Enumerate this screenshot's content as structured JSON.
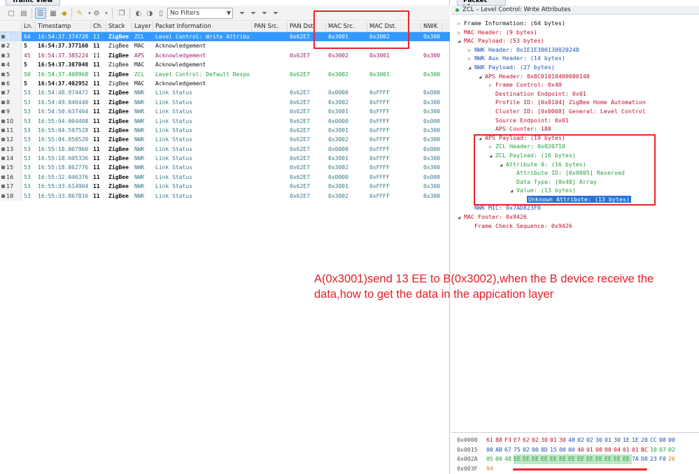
{
  "traffic_view": {
    "title": "Traffic View",
    "filter_value": "No Filters",
    "columns": [
      "Ln.",
      "Timestamp",
      "Ch.",
      "Stack",
      "Layer",
      "Packet Information",
      "PAN Src.",
      "PAN Dst.",
      "MAC Src.",
      "MAC Dst.",
      "NWK"
    ],
    "rows": [
      {
        "ln": "1",
        "prefix": "64",
        "ts": "16:54:37.374728",
        "ch": "11",
        "stack": "ZigBee",
        "layer": "ZCL",
        "info": "Level Control: Write Attribu",
        "pan_src": "",
        "pan_dst": "0x62E7",
        "mac_src": "0x3001",
        "mac_dst": "0x3002",
        "nwk": "0x300",
        "kind": "zcl",
        "selected": true
      },
      {
        "ln": "2",
        "prefix": "5",
        "ts": "16:54:37.377160",
        "ch": "11",
        "stack": "ZigBee",
        "layer": "MAC",
        "info": "Acknowledgement",
        "pan_src": "",
        "pan_dst": "",
        "mac_src": "",
        "mac_dst": "",
        "nwk": "",
        "kind": "mac"
      },
      {
        "ln": "3",
        "prefix": "45",
        "ts": "16:54:37.385224",
        "ch": "11",
        "stack": "ZigBee",
        "layer": "APS",
        "info": "Acknowledgement",
        "pan_src": "",
        "pan_dst": "0x62E7",
        "mac_src": "0x3002",
        "mac_dst": "0x3001",
        "nwk": "0x300",
        "kind": "aps"
      },
      {
        "ln": "4",
        "prefix": "5",
        "ts": "16:54:37.387048",
        "ch": "11",
        "stack": "ZigBee",
        "layer": "MAC",
        "info": "Acknowledgement",
        "pan_src": "",
        "pan_dst": "",
        "mac_src": "",
        "mac_dst": "",
        "nwk": "",
        "kind": "mac"
      },
      {
        "ln": "5",
        "prefix": "50",
        "ts": "16:54:37.400968",
        "ch": "11",
        "stack": "ZigBee",
        "layer": "ZCL",
        "info": "Level Control: Default Respo",
        "pan_src": "",
        "pan_dst": "0x62E7",
        "mac_src": "0x3002",
        "mac_dst": "0x3001",
        "nwk": "0x300",
        "kind": "zcl"
      },
      {
        "ln": "6",
        "prefix": "5",
        "ts": "16:54:37.402952",
        "ch": "11",
        "stack": "ZigBee",
        "layer": "MAC",
        "info": "Acknowledgement",
        "pan_src": "",
        "pan_dst": "",
        "mac_src": "",
        "mac_dst": "",
        "nwk": "",
        "kind": "mac"
      },
      {
        "ln": "7",
        "prefix": "53",
        "ts": "16:54:48.974472",
        "ch": "11",
        "stack": "ZigBee",
        "layer": "NWK",
        "info": "Link Status",
        "pan_src": "",
        "pan_dst": "0x62E7",
        "mac_src": "0x0000",
        "mac_dst": "0xFFFF",
        "nwk": "0x000",
        "kind": "nwk"
      },
      {
        "ln": "8",
        "prefix": "53",
        "ts": "16:54:49.846440",
        "ch": "11",
        "stack": "ZigBee",
        "layer": "NWK",
        "info": "Link Status",
        "pan_src": "",
        "pan_dst": "0x62E7",
        "mac_src": "0x3002",
        "mac_dst": "0xFFFF",
        "nwk": "0x300",
        "kind": "nwk"
      },
      {
        "ln": "9",
        "prefix": "53",
        "ts": "16:54:50.637464",
        "ch": "11",
        "stack": "ZigBee",
        "layer": "NWK",
        "info": "Link Status",
        "pan_src": "",
        "pan_dst": "0x62E7",
        "mac_src": "0x3001",
        "mac_dst": "0xFFFF",
        "nwk": "0x300",
        "kind": "nwk"
      },
      {
        "ln": "10",
        "prefix": "53",
        "ts": "16:55:04.004408",
        "ch": "11",
        "stack": "ZigBee",
        "layer": "NWK",
        "info": "Link Status",
        "pan_src": "",
        "pan_dst": "0x62E7",
        "mac_src": "0x0000",
        "mac_dst": "0xFFFF",
        "nwk": "0x000",
        "kind": "nwk"
      },
      {
        "ln": "11",
        "prefix": "53",
        "ts": "16:55:04.597528",
        "ch": "11",
        "stack": "ZigBee",
        "layer": "NWK",
        "info": "Link Status",
        "pan_src": "",
        "pan_dst": "0x62E7",
        "mac_src": "0x3001",
        "mac_dst": "0xFFFF",
        "nwk": "0x300",
        "kind": "nwk"
      },
      {
        "ln": "12",
        "prefix": "53",
        "ts": "16:55:04.850520",
        "ch": "11",
        "stack": "ZigBee",
        "layer": "NWK",
        "info": "Link Status",
        "pan_src": "",
        "pan_dst": "0x62E7",
        "mac_src": "0x3002",
        "mac_dst": "0xFFFF",
        "nwk": "0x300",
        "kind": "nwk"
      },
      {
        "ln": "13",
        "prefix": "53",
        "ts": "16:55:18.007960",
        "ch": "11",
        "stack": "ZigBee",
        "layer": "NWK",
        "info": "Link Status",
        "pan_src": "",
        "pan_dst": "0x62E7",
        "mac_src": "0x0000",
        "mac_dst": "0xFFFF",
        "nwk": "0x000",
        "kind": "nwk"
      },
      {
        "ln": "14",
        "prefix": "53",
        "ts": "16:55:18.605336",
        "ch": "11",
        "stack": "ZigBee",
        "layer": "NWK",
        "info": "Link Status",
        "pan_src": "",
        "pan_dst": "0x62E7",
        "mac_src": "0x3001",
        "mac_dst": "0xFFFF",
        "nwk": "0x300",
        "kind": "nwk"
      },
      {
        "ln": "15",
        "prefix": "53",
        "ts": "16:55:18.862776",
        "ch": "11",
        "stack": "ZigBee",
        "layer": "NWK",
        "info": "Link Status",
        "pan_src": "",
        "pan_dst": "0x62E7",
        "mac_src": "0x3002",
        "mac_dst": "0xFFFF",
        "nwk": "0x300",
        "kind": "nwk"
      },
      {
        "ln": "16",
        "prefix": "53",
        "ts": "16:55:32.046376",
        "ch": "11",
        "stack": "ZigBee",
        "layer": "NWK",
        "info": "Link Status",
        "pan_src": "",
        "pan_dst": "0x62E7",
        "mac_src": "0x0000",
        "mac_dst": "0xFFFF",
        "nwk": "0x000",
        "kind": "nwk"
      },
      {
        "ln": "17",
        "prefix": "53",
        "ts": "16:55:33.614904",
        "ch": "11",
        "stack": "ZigBee",
        "layer": "NWK",
        "info": "Link Status",
        "pan_src": "",
        "pan_dst": "0x62E7",
        "mac_src": "0x3001",
        "mac_dst": "0xFFFF",
        "nwk": "0x300",
        "kind": "nwk"
      },
      {
        "ln": "18",
        "prefix": "53",
        "ts": "16:55:33.867816",
        "ch": "11",
        "stack": "ZigBee",
        "layer": "NWK",
        "info": "Link Status",
        "pan_src": "",
        "pan_dst": "0x62E7",
        "mac_src": "0x3002",
        "mac_dst": "0xFFFF",
        "nwk": "0x300",
        "kind": "nwk"
      }
    ]
  },
  "packet_view": {
    "title": "Packet View",
    "caption": "ZCL – Level Control: Write Attributes",
    "tree": [
      {
        "indent": 0,
        "exp": "right",
        "color": "black",
        "text": "Frame Information: (64 bytes)"
      },
      {
        "indent": 0,
        "exp": "right",
        "color": "red",
        "text": "MAC Header: (9 bytes)"
      },
      {
        "indent": 0,
        "exp": "down",
        "color": "red",
        "text": "MAC Payload: (53 bytes)"
      },
      {
        "indent": 1,
        "exp": "right",
        "color": "blue",
        "text": "NWK Header: 0x1E1E300130020248"
      },
      {
        "indent": 1,
        "exp": "right",
        "color": "blue",
        "text": "NWK Aux Header: (14 bytes)"
      },
      {
        "indent": 1,
        "exp": "down",
        "color": "blue",
        "text": "NWK Payload: (27 bytes)"
      },
      {
        "indent": 2,
        "exp": "down",
        "color": "red",
        "text": "APS Header: 0x8C01010400080140"
      },
      {
        "indent": 3,
        "exp": "right",
        "color": "red",
        "text": "Frame Control: 0x40"
      },
      {
        "indent": 3,
        "exp": "",
        "color": "red",
        "text": "Destination Endpoint: 0x01"
      },
      {
        "indent": 3,
        "exp": "",
        "color": "red",
        "text": "Profile ID: [0x0104] ZigBee Home Automation"
      },
      {
        "indent": 3,
        "exp": "",
        "color": "red",
        "text": "Cluster ID: [0x0008] General: Level Control"
      },
      {
        "indent": 3,
        "exp": "",
        "color": "red",
        "text": "Source Endpoint: 0x01"
      },
      {
        "indent": 3,
        "exp": "",
        "color": "red",
        "text": "APS Counter: 188"
      },
      {
        "indent": 2,
        "exp": "down",
        "color": "red",
        "text": "APS Payload: (19 bytes)"
      },
      {
        "indent": 3,
        "exp": "right",
        "color": "green",
        "text": "ZCL Header: 0x020710"
      },
      {
        "indent": 3,
        "exp": "down",
        "color": "green",
        "text": "ZCL Payload: (16 bytes)"
      },
      {
        "indent": 4,
        "exp": "down",
        "color": "green",
        "text": "Attribute 0: (16 bytes)"
      },
      {
        "indent": 5,
        "exp": "",
        "color": "green",
        "text": "Attribute ID: [0x0005] Reserved"
      },
      {
        "indent": 5,
        "exp": "",
        "color": "green",
        "text": "Data Type: [0x48] Array"
      },
      {
        "indent": 5,
        "exp": "down",
        "color": "green",
        "text": "Value: (13 bytes)"
      },
      {
        "indent": 6,
        "exp": "",
        "color": "green",
        "text": "Unknown Attribute: (13 bytes)",
        "highlight": true
      },
      {
        "indent": 1,
        "exp": "",
        "color": "blue",
        "text": "NWK MIC: 0x7AD823F0"
      },
      {
        "indent": 0,
        "exp": "down",
        "color": "red",
        "text": "MAC Footer: 0x9426"
      },
      {
        "indent": 1,
        "exp": "",
        "color": "red",
        "text": "Frame Check Sequence: 0x9426"
      }
    ],
    "hex": [
      {
        "offset": "0x0000",
        "bytes": [
          [
            "61",
            "red"
          ],
          [
            "88",
            "red"
          ],
          [
            "F3",
            "red"
          ],
          [
            "E7",
            "red"
          ],
          [
            "62",
            "red"
          ],
          [
            "02",
            "red"
          ],
          [
            "30",
            "red"
          ],
          [
            "01",
            "red"
          ],
          [
            "30",
            "red"
          ],
          [
            "48",
            "blue"
          ],
          [
            "02",
            "blue"
          ],
          [
            "02",
            "blue"
          ],
          [
            "30",
            "blue"
          ],
          [
            "01",
            "blue"
          ],
          [
            "30",
            "blue"
          ],
          [
            "1E",
            "blue"
          ],
          [
            "1E",
            "blue"
          ],
          [
            "28",
            "blue"
          ],
          [
            "CC",
            "blue"
          ],
          [
            "08",
            "blue"
          ],
          [
            "00",
            "blue"
          ]
        ]
      },
      {
        "offset": "0x0015",
        "bytes": [
          [
            "00",
            "blue"
          ],
          [
            "AB",
            "blue"
          ],
          [
            "67",
            "blue"
          ],
          [
            "75",
            "blue"
          ],
          [
            "02",
            "blue"
          ],
          [
            "00",
            "blue"
          ],
          [
            "8D",
            "blue"
          ],
          [
            "15",
            "blue"
          ],
          [
            "00",
            "blue"
          ],
          [
            "00",
            "blue"
          ],
          [
            "40",
            "red"
          ],
          [
            "01",
            "red"
          ],
          [
            "08",
            "red"
          ],
          [
            "00",
            "red"
          ],
          [
            "04",
            "red"
          ],
          [
            "01",
            "red"
          ],
          [
            "01",
            "red"
          ],
          [
            "BC",
            "red"
          ],
          [
            "10",
            "green"
          ],
          [
            "07",
            "green"
          ],
          [
            "02",
            "green"
          ]
        ]
      },
      {
        "offset": "0x002A",
        "bytes": [
          [
            "05",
            "green"
          ],
          [
            "00",
            "green"
          ],
          [
            "48",
            "green"
          ],
          [
            "EE",
            "hlg"
          ],
          [
            "EE",
            "hlg"
          ],
          [
            "EE",
            "hlg"
          ],
          [
            "EE",
            "hlg"
          ],
          [
            "EE",
            "hlg"
          ],
          [
            "EE",
            "hlg"
          ],
          [
            "EE",
            "hlg"
          ],
          [
            "EE",
            "hlg"
          ],
          [
            "EE",
            "hlg"
          ],
          [
            "EE",
            "hlg"
          ],
          [
            "EE",
            "hlg"
          ],
          [
            "EE",
            "hlg"
          ],
          [
            "EE",
            "hlg"
          ],
          [
            "7A",
            "blue"
          ],
          [
            "D8",
            "blue"
          ],
          [
            "23",
            "blue"
          ],
          [
            "F0",
            "blue"
          ],
          [
            "26",
            "orange"
          ]
        ]
      },
      {
        "offset": "0x003F",
        "bytes": [
          [
            "94",
            "orange"
          ]
        ]
      }
    ]
  },
  "annotation": {
    "text": "A(0x3001)send 13 EE to B(0x3002),when the B device receive the data,how to get the data in the appication layer"
  },
  "colors": {
    "selected_row": "#3399ff",
    "annotation_red": "#e51e25",
    "zcl_green": "#1e9e3e",
    "aps_purple": "#9b1c6a",
    "nwk_teal": "#3a7a86"
  }
}
